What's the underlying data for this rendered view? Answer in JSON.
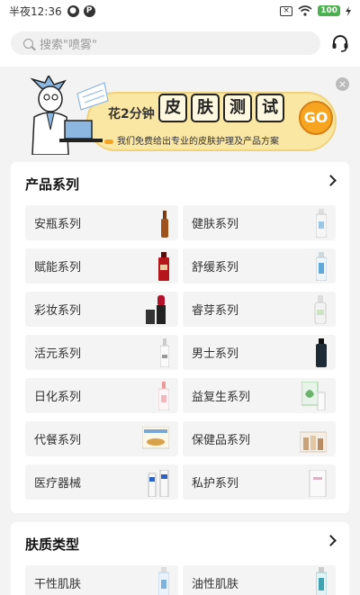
{
  "status_bar": {
    "time": "半夜12:36",
    "battery": "100"
  },
  "search": {
    "placeholder": "搜索\"喷雾\""
  },
  "banner": {
    "lead": "花2分钟",
    "words": [
      "皮",
      "肤",
      "测",
      "试"
    ],
    "go": "GO",
    "subtitle": "我们免费给出专业的皮肤护理及产品方案",
    "close": "×"
  },
  "product_series": {
    "title": "产品系列",
    "items": [
      {
        "label": "安瓶系列",
        "thumb": "ampoule"
      },
      {
        "label": "健肤系列",
        "thumb": "white-bottle"
      },
      {
        "label": "赋能系列",
        "thumb": "red-bottle"
      },
      {
        "label": "舒缓系列",
        "thumb": "blue-bottle"
      },
      {
        "label": "彩妆系列",
        "thumb": "lipstick"
      },
      {
        "label": "睿芽系列",
        "thumb": "pump-bottle"
      },
      {
        "label": "活元系列",
        "thumb": "clear-bottle"
      },
      {
        "label": "男士系列",
        "thumb": "black-bottle"
      },
      {
        "label": "日化系列",
        "thumb": "spray-bottle"
      },
      {
        "label": "益复生系列",
        "thumb": "green-box"
      },
      {
        "label": "代餐系列",
        "thumb": "food-box"
      },
      {
        "label": "保健品系列",
        "thumb": "supplement-set"
      },
      {
        "label": "医疗器械",
        "thumb": "medical-set"
      },
      {
        "label": "私护系列",
        "thumb": "white-box"
      }
    ]
  },
  "skin_type": {
    "title": "肤质类型",
    "items": [
      {
        "label": "干性肌肤",
        "thumb": "blue-tube"
      },
      {
        "label": "油性肌肤",
        "thumb": "teal-tube"
      }
    ]
  }
}
